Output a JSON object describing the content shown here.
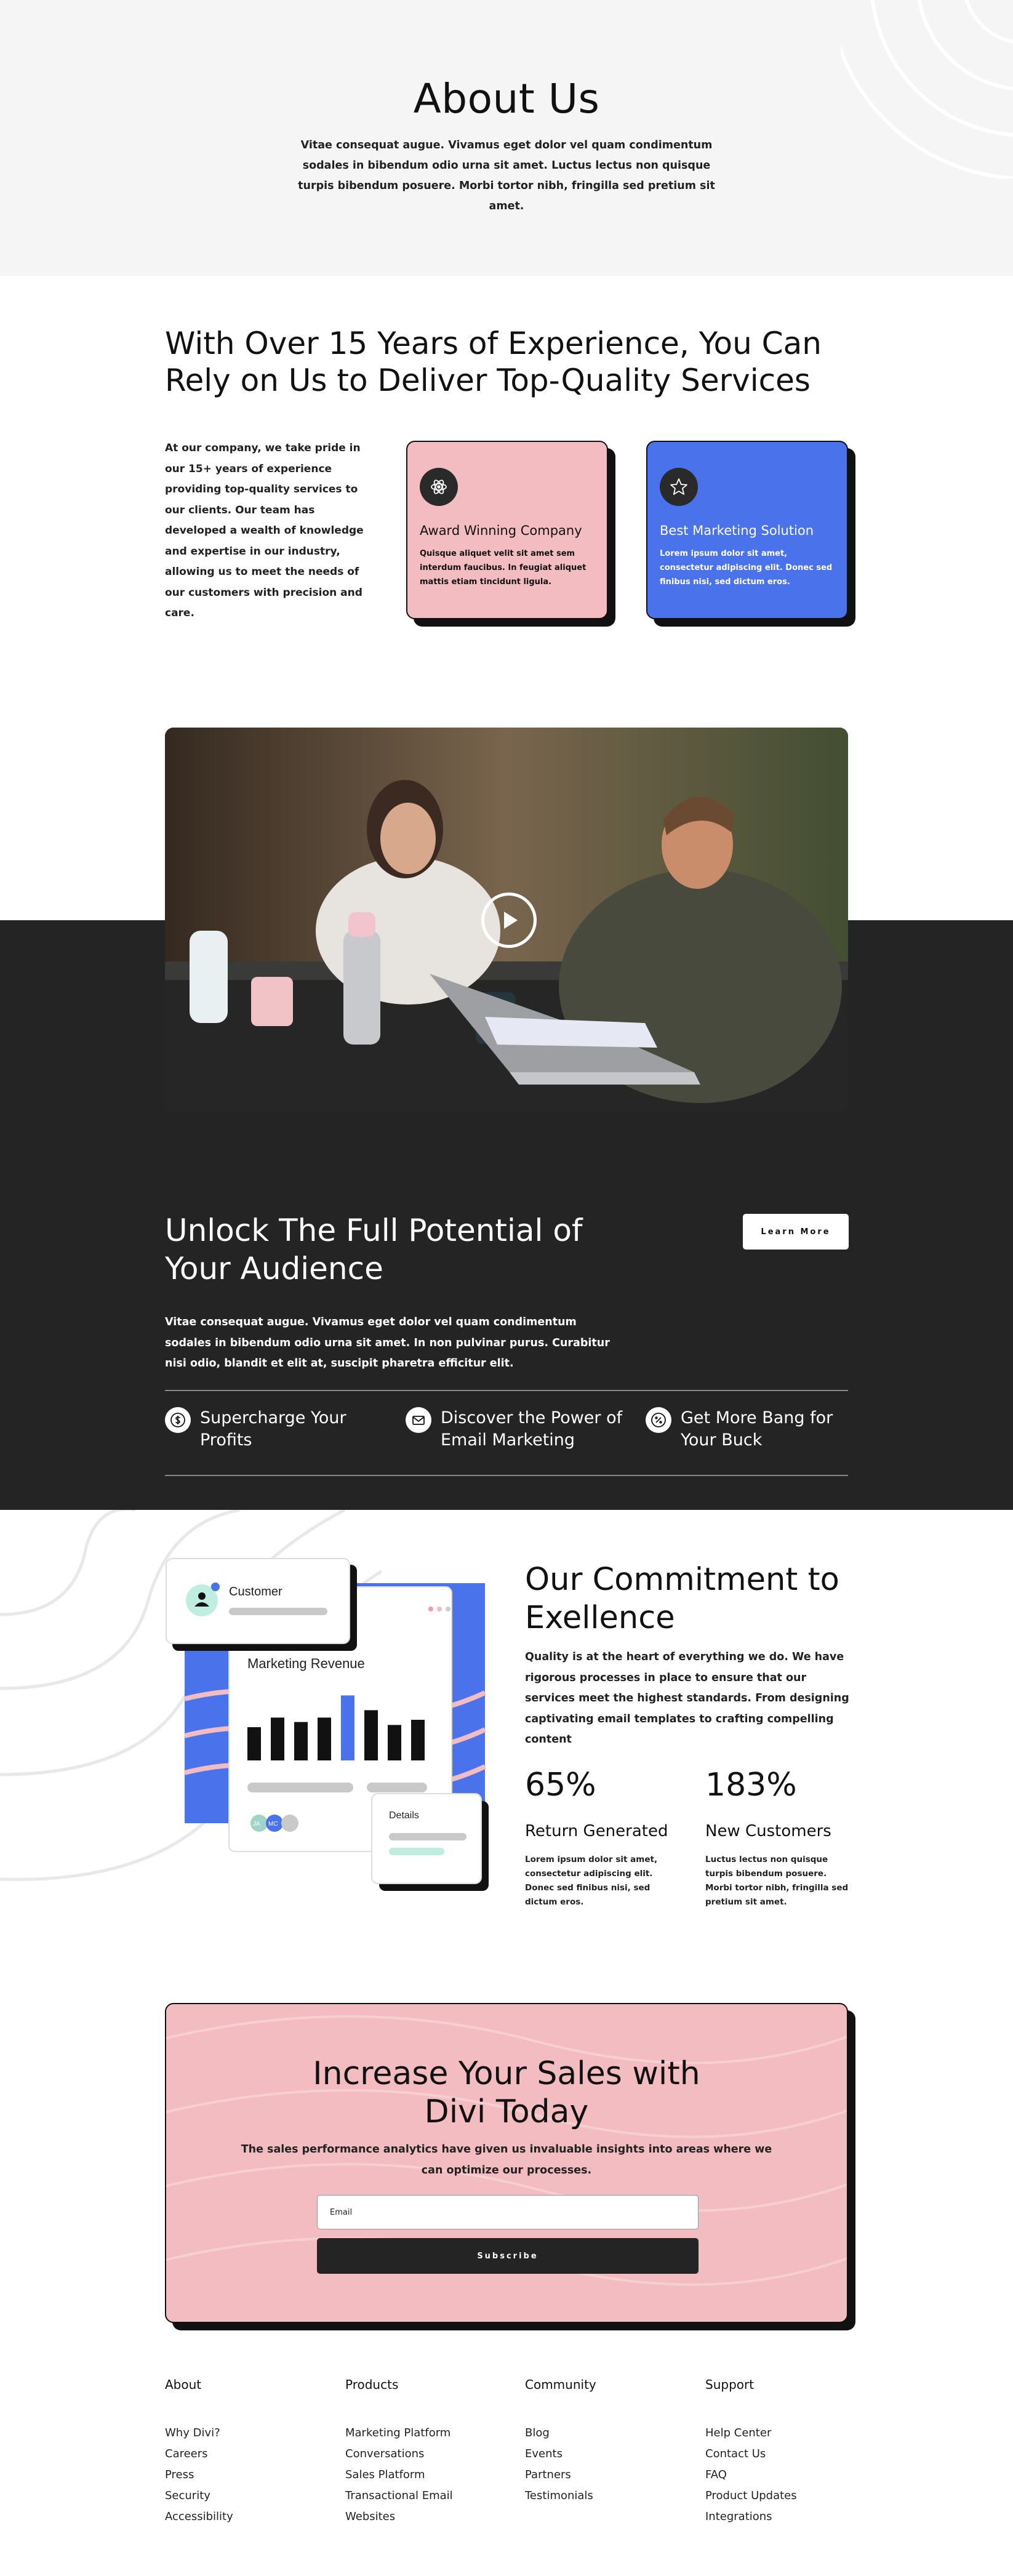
{
  "hero": {
    "title": "About Us",
    "subtitle": "Vitae consequat augue. Vivamus eget dolor vel quam condimentum sodales in bibendum odio urna sit amet. Luctus lectus non quisque turpis bibendum posuere. Morbi tortor nibh, fringilla sed pretium sit amet."
  },
  "experience": {
    "title": "With Over 15 Years of Experience, You Can Rely on Us to Deliver Top-Quality Services",
    "text": "At our company, we take pride in our 15+ years of experience providing top-quality services to our clients. Our team has developed a wealth of knowledge and expertise in our industry, allowing us to meet the needs of our customers with precision and care.",
    "cards": [
      {
        "icon": "atom-icon",
        "title": "Award Winning Company",
        "text": "Quisque aliquet velit sit amet sem interdum faucibus. In feugiat aliquet mattis etiam tincidunt ligula.",
        "color": "#f2bcc0"
      },
      {
        "icon": "star-icon",
        "title": "Best Marketing Solution",
        "text": "Lorem ipsum dolor sit amet, consectetur adipiscing elit. Donec sed finibus nisi, sed dictum eros.",
        "color": "#4a72ea"
      }
    ]
  },
  "video": {
    "icon": "play-icon"
  },
  "unlock": {
    "title": "Unlock The Full Potential of Your Audience",
    "button": "Learn More",
    "text": "Vitae consequat augue. Vivamus eget dolor vel quam condimentum sodales in bibendum odio urna sit amet. In non pulvinar purus. Curabitur nisi odio, blandit et elit at, suscipit pharetra efficitur elit.",
    "features": [
      {
        "icon": "dollar-icon",
        "label": "Supercharge Your Profits"
      },
      {
        "icon": "mail-icon",
        "label": "Discover the Power of Email Marketing"
      },
      {
        "icon": "percent-icon",
        "label": "Get More Bang for Your Buck"
      }
    ]
  },
  "illustration": {
    "customer_label": "Customer",
    "revenue_label": "Marketing Revenue",
    "details_label": "Details",
    "avatar_labels": [
      "JA",
      "MC"
    ],
    "bar_levels": [
      0.45,
      0.58,
      0.52,
      0.58,
      0.88,
      0.68,
      0.48,
      0.55
    ],
    "highlight_bar": 4
  },
  "commitment": {
    "title": "Our Commitment to Exellence",
    "text": "Quality is at the heart of everything we do. We have rigorous processes in place to ensure that our services meet the highest standards. From designing captivating email templates to crafting compelling content",
    "stats": [
      {
        "value": "65%",
        "label": "Return Generated",
        "text": "Lorem ipsum dolor sit amet, consectetur adipiscing elit. Donec sed finibus nisi, sed dictum eros."
      },
      {
        "value": "183%",
        "label": "New Customers",
        "text": "Luctus lectus non quisque turpis bibendum posuere. Morbi tortor nibh, fringilla sed pretium sit amet."
      }
    ]
  },
  "cta": {
    "title": "Increase Your Sales with Divi Today",
    "text": "The sales performance analytics have given us invaluable insights into areas where we can optimize our processes.",
    "email_placeholder": "Email",
    "button": "Subscribe"
  },
  "footer": {
    "columns": [
      {
        "heading": "About",
        "links": [
          "Why Divi?",
          "Careers",
          "Press",
          "Security",
          "Accessibility"
        ]
      },
      {
        "heading": "Products",
        "links": [
          "Marketing Platform",
          "Conversations",
          "Sales Platform",
          "Transactional Email",
          "Websites"
        ]
      },
      {
        "heading": "Community",
        "links": [
          "Blog",
          "Events",
          "Partners",
          "Testimonials"
        ]
      },
      {
        "heading": "Support",
        "links": [
          "Help Center",
          "Contact Us",
          "FAQ",
          "Product Updates",
          "Integrations"
        ]
      }
    ]
  },
  "colors": {
    "pink": "#f2bcc0",
    "blue": "#4a72ea",
    "dark": "#242424",
    "mint": "#bfeee0"
  }
}
